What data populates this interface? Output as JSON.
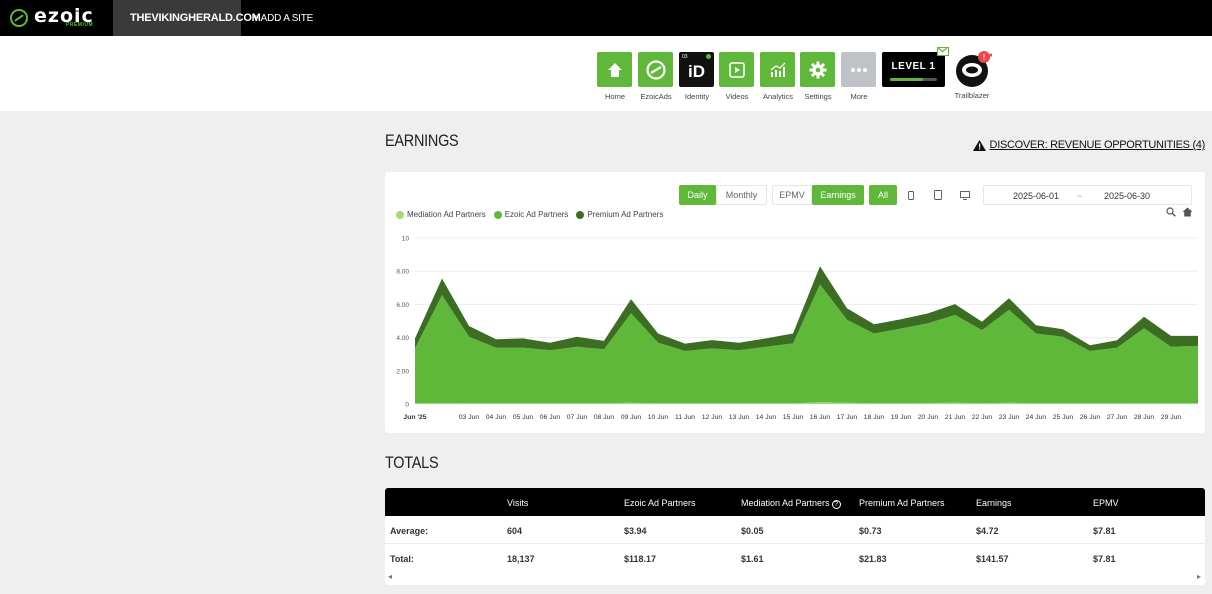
{
  "topbar": {
    "brand": "ezoic",
    "brand_sub": "PREMIUM",
    "site": "THEVIKINGHERALD.COM",
    "add_site": "+ ADD A SITE"
  },
  "nav": {
    "items": [
      {
        "label": "Home",
        "icon": "home-icon"
      },
      {
        "label": "EzoicAds",
        "icon": "ezoic-ads-icon"
      },
      {
        "label": "Identity",
        "icon": "identity-icon",
        "glyph": "iD",
        "small": "03"
      },
      {
        "label": "Videos",
        "icon": "video-icon"
      },
      {
        "label": "Analytics",
        "icon": "analytics-icon"
      },
      {
        "label": "Settings",
        "icon": "gear-icon"
      },
      {
        "label": "More",
        "icon": "more-icon"
      }
    ],
    "level": "LEVEL 1",
    "level_progress": 0.7,
    "trailblazer": "Trailblazer"
  },
  "earnings": {
    "title": "EARNINGS",
    "discover": "DISCOVER: REVENUE OPPORTUNITIES (4)",
    "buttons": {
      "daily": "Daily",
      "monthly": "Monthly",
      "epmv": "EPMV",
      "earnings": "Earnings",
      "all": "All"
    },
    "date_from": "2025-06-01",
    "date_sep": "~",
    "date_to": "2025-06-30"
  },
  "chart_data": {
    "type": "area",
    "stacked": true,
    "x": [
      "Jun '25",
      "",
      "03 Jun",
      "04 Jun",
      "05 Jun",
      "06 Jun",
      "07 Jun",
      "08 Jun",
      "09 Jun",
      "10 Jun",
      "11 Jun",
      "12 Jun",
      "13 Jun",
      "14 Jun",
      "15 Jun",
      "16 Jun",
      "17 Jun",
      "18 Jun",
      "19 Jun",
      "20 Jun",
      "21 Jun",
      "22 Jun",
      "23 Jun",
      "24 Jun",
      "25 Jun",
      "26 Jun",
      "27 Jun",
      "28 Jun",
      "29 Jun",
      ""
    ],
    "yticks": [
      "0",
      "2.00",
      "4.00",
      "6.00",
      "8.00",
      "10"
    ],
    "ylim": [
      0,
      10
    ],
    "grid": true,
    "legend_position": "top-left",
    "series": [
      {
        "name": "Mediation Ad Partners",
        "color": "#a3d977",
        "values": [
          0.05,
          0.06,
          0.05,
          0.05,
          0.05,
          0.04,
          0.05,
          0.05,
          0.07,
          0.05,
          0.04,
          0.05,
          0.04,
          0.05,
          0.05,
          0.1,
          0.07,
          0.05,
          0.05,
          0.06,
          0.07,
          0.05,
          0.07,
          0.05,
          0.05,
          0.04,
          0.04,
          0.06,
          0.05,
          0.05
        ]
      },
      {
        "name": "Ezoic Ad Partners",
        "color": "#5fb83a",
        "values": [
          3.3,
          6.5,
          4.0,
          3.35,
          3.35,
          3.2,
          3.4,
          3.25,
          5.4,
          3.65,
          3.15,
          3.3,
          3.2,
          3.4,
          3.6,
          7.1,
          5.0,
          4.2,
          4.5,
          4.8,
          5.3,
          4.4,
          5.6,
          4.2,
          4.0,
          3.15,
          3.35,
          4.5,
          3.4,
          3.45
        ]
      },
      {
        "name": "Premium Ad Partners",
        "color": "#3b6d22",
        "values": [
          0.6,
          1.0,
          0.65,
          0.5,
          0.55,
          0.45,
          0.6,
          0.5,
          0.85,
          0.55,
          0.45,
          0.5,
          0.45,
          0.5,
          0.6,
          1.1,
          0.7,
          0.55,
          0.55,
          0.6,
          0.65,
          0.5,
          0.7,
          0.5,
          0.45,
          0.35,
          0.45,
          0.7,
          0.65,
          0.6
        ]
      }
    ]
  },
  "totals": {
    "title": "TOTALS",
    "columns": [
      "",
      "Visits",
      "Ezoic Ad Partners",
      "Mediation Ad Partners",
      "Premium Ad Partners",
      "Earnings",
      "EPMV"
    ],
    "rows": [
      [
        "Average:",
        "604",
        "$3.94",
        "$0.05",
        "$0.73",
        "$4.72",
        "$7.81"
      ],
      [
        "Total:",
        "18,137",
        "$118.17",
        "$1.61",
        "$21.83",
        "$141.57",
        "$7.81"
      ]
    ]
  }
}
